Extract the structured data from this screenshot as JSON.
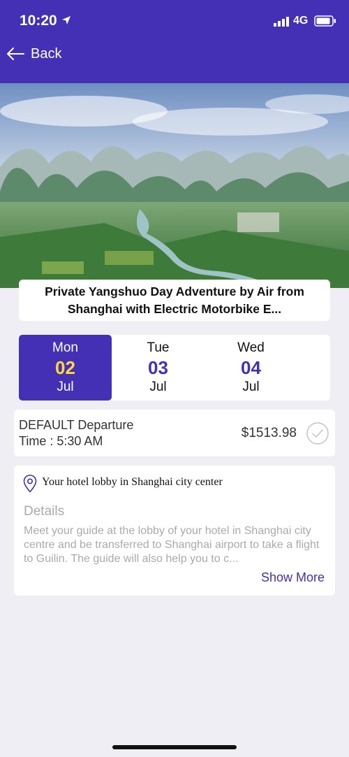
{
  "status_bar": {
    "time": "10:20",
    "network": "4G"
  },
  "header": {
    "back_label": "Back"
  },
  "tour": {
    "title": "Private Yangshuo Day Adventure by Air from Shanghai with Electric Motorbike E..."
  },
  "dates": [
    {
      "dow": "Mon",
      "day": "02",
      "month": "Jul",
      "selected": true
    },
    {
      "dow": "Tue",
      "day": "03",
      "month": "Jul",
      "selected": false
    },
    {
      "dow": "Wed",
      "day": "04",
      "month": "Jul",
      "selected": false
    }
  ],
  "departure": {
    "line1": "DEFAULT Departure",
    "line2": "Time : 5:30 AM",
    "price": "$1513.98"
  },
  "meeting": {
    "location": "Your hotel lobby in Shanghai city center",
    "details_heading": "Details",
    "details_text": "Meet your guide at the lobby of your hotel in Shanghai city centre and be transferred to Shanghai airport to take a flight to Guilin. The guide will also help you to c...",
    "show_more": "Show More"
  },
  "colors": {
    "brand": "#4330b5",
    "highlight": "#ffd740",
    "background": "#efeef4"
  }
}
